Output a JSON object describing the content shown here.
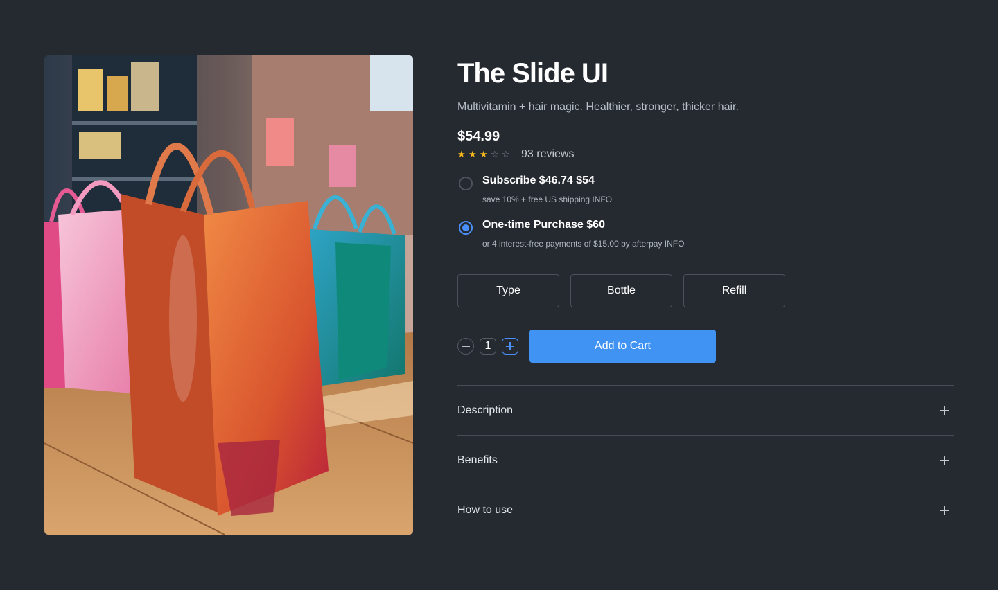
{
  "product": {
    "image_alt": "Glossy shopping bags",
    "title": "The Slide UI",
    "subtitle": "Multivitamin + hair magic. Healthier, stronger, thicker hair.",
    "price": "$54.99",
    "rating": {
      "filled": 3,
      "total": 5,
      "reviews": "93 reviews"
    }
  },
  "purchase_options": [
    {
      "title": "Subscribe $46.74 $54",
      "sub": "save 10% + free US shipping INFO",
      "checked": false
    },
    {
      "title": "One-time Purchase $60",
      "sub": "or 4 interest-free payments of $15.00 by afterpay INFO",
      "checked": true
    }
  ],
  "variants": [
    "Type",
    "Bottle",
    "Refill"
  ],
  "cart": {
    "quantity": "1",
    "add_label": "Add to Cart"
  },
  "accordion": [
    "Description",
    "Benefits",
    "How to use"
  ],
  "colors": {
    "background": "#242a30",
    "accent": "#4193f3",
    "star": "#f5b81c"
  }
}
